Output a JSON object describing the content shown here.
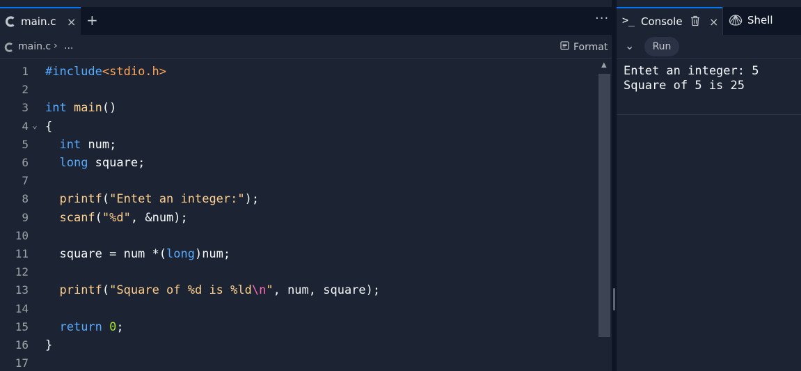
{
  "editor": {
    "tab": {
      "label": "main.c",
      "close": "×",
      "add": "+",
      "menu": "···"
    },
    "breadcrumb": {
      "file": "main.c",
      "chevron": "›",
      "ellipsis": "..."
    },
    "format_label": "Format",
    "language": "C",
    "lines": [
      {
        "n": "1",
        "tokens": [
          {
            "t": "#include",
            "c": "kw"
          },
          {
            "t": "<stdio.h>",
            "c": "inc"
          }
        ]
      },
      {
        "n": "2",
        "tokens": []
      },
      {
        "n": "3",
        "tokens": [
          {
            "t": "int ",
            "c": "kw"
          },
          {
            "t": "main",
            "c": "fn"
          },
          {
            "t": "()",
            "c": ""
          }
        ]
      },
      {
        "n": "4",
        "fold": "⌄",
        "tokens": [
          {
            "t": "{",
            "c": ""
          }
        ]
      },
      {
        "n": "5",
        "tokens": [
          {
            "t": "  ",
            "c": ""
          },
          {
            "t": "int",
            "c": "kw"
          },
          {
            "t": " num;",
            "c": ""
          }
        ]
      },
      {
        "n": "6",
        "tokens": [
          {
            "t": "  ",
            "c": ""
          },
          {
            "t": "long",
            "c": "kw"
          },
          {
            "t": " square;",
            "c": ""
          }
        ]
      },
      {
        "n": "7",
        "tokens": []
      },
      {
        "n": "8",
        "tokens": [
          {
            "t": "  ",
            "c": ""
          },
          {
            "t": "printf",
            "c": "fn"
          },
          {
            "t": "(",
            "c": ""
          },
          {
            "t": "\"Entet an integer:\"",
            "c": "str"
          },
          {
            "t": ");",
            "c": ""
          }
        ]
      },
      {
        "n": "9",
        "tokens": [
          {
            "t": "  ",
            "c": ""
          },
          {
            "t": "scanf",
            "c": "fn"
          },
          {
            "t": "(",
            "c": ""
          },
          {
            "t": "\"%d\"",
            "c": "str"
          },
          {
            "t": ", &num);",
            "c": ""
          }
        ]
      },
      {
        "n": "10",
        "tokens": []
      },
      {
        "n": "11",
        "tokens": [
          {
            "t": "  square = num *(",
            "c": ""
          },
          {
            "t": "long",
            "c": "kw"
          },
          {
            "t": ")num;",
            "c": ""
          }
        ]
      },
      {
        "n": "12",
        "tokens": []
      },
      {
        "n": "13",
        "tokens": [
          {
            "t": "  ",
            "c": ""
          },
          {
            "t": "printf",
            "c": "fn"
          },
          {
            "t": "(",
            "c": ""
          },
          {
            "t": "\"Square of %d is %ld",
            "c": "str"
          },
          {
            "t": "\\n",
            "c": "esc"
          },
          {
            "t": "\"",
            "c": "str"
          },
          {
            "t": ", num, square);",
            "c": ""
          }
        ]
      },
      {
        "n": "14",
        "tokens": []
      },
      {
        "n": "15",
        "tokens": [
          {
            "t": "  ",
            "c": ""
          },
          {
            "t": "return",
            "c": "kw"
          },
          {
            "t": " ",
            "c": ""
          },
          {
            "t": "0",
            "c": "num"
          },
          {
            "t": ";",
            "c": ""
          }
        ]
      },
      {
        "n": "16",
        "tokens": [
          {
            "t": "}",
            "c": ""
          }
        ]
      },
      {
        "n": "17",
        "tokens": []
      }
    ]
  },
  "console": {
    "tab_label": "Console",
    "prompt_icon": ">_",
    "close": "×",
    "shell_label": "Shell",
    "run_label": "Run",
    "collapse": "⌄",
    "output": "Entet an integer: 5\nSquare of 5 is 25"
  },
  "colors": {
    "accent": "#0079f2",
    "keyword": "#57abff",
    "function": "#ffcf8b",
    "number": "#a6e22e",
    "escape": "#ff69b4"
  }
}
